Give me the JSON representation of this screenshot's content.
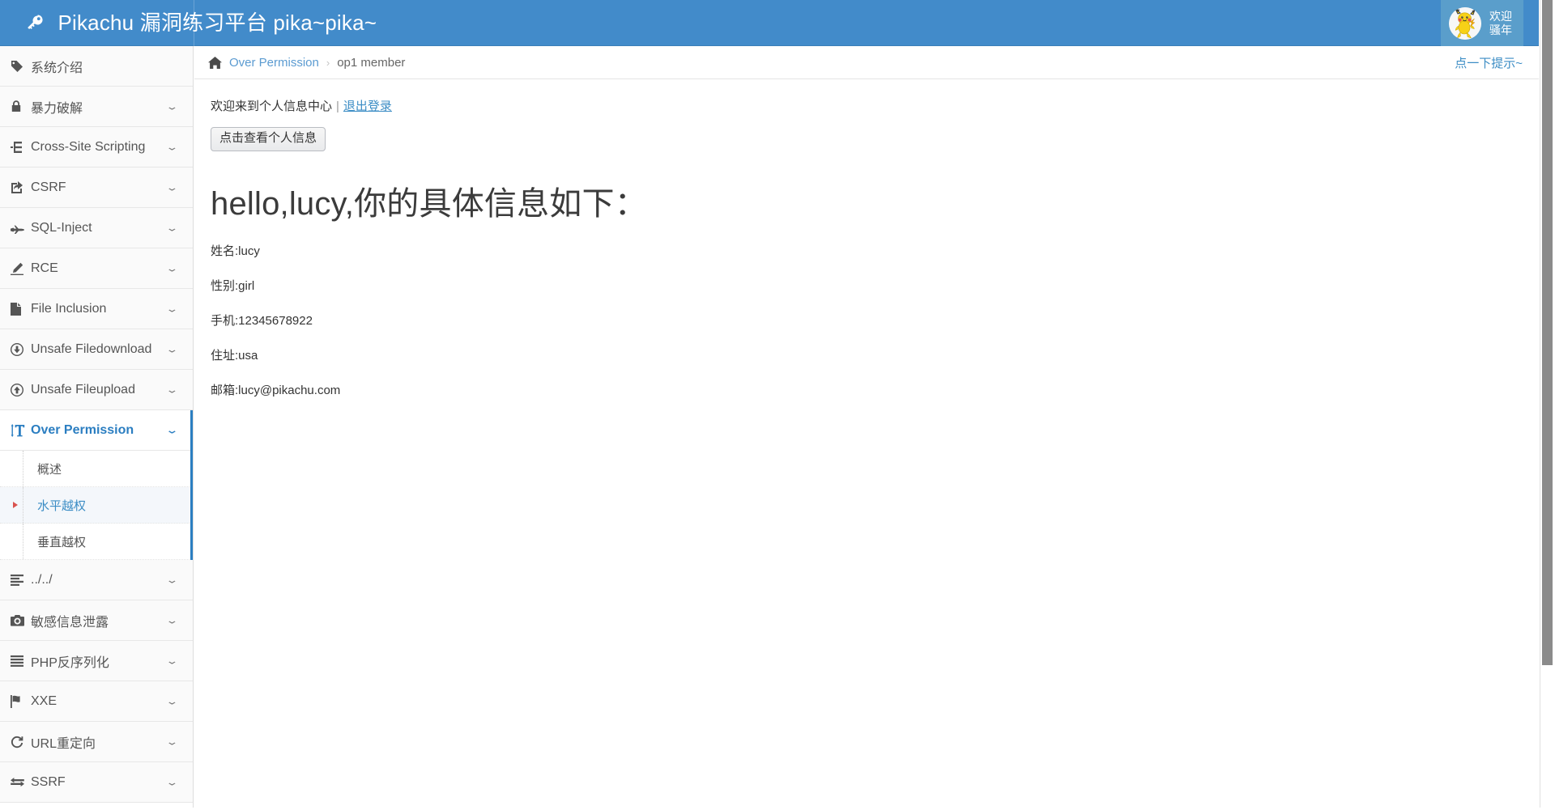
{
  "header": {
    "title": "Pikachu 漏洞练习平台 pika~pika~",
    "key_icon": "key-icon",
    "user": {
      "avatar": "pikachu-avatar",
      "line1": "欢迎",
      "line2": "骚年"
    },
    "colors": {
      "brand_blue": "#428bca",
      "user_box_blue": "#5a9ecb",
      "accent": "#2b7ec1"
    }
  },
  "sidebar": {
    "items": [
      {
        "label": "系统介绍",
        "icon": "tag-icon",
        "chevron": "",
        "active": false
      },
      {
        "label": "暴力破解",
        "icon": "lock-icon",
        "chevron": "⌄",
        "active": false
      },
      {
        "label": "Cross-Site Scripting",
        "icon": "sitemap-icon",
        "chevron": "⌄",
        "active": false
      },
      {
        "label": "CSRF",
        "icon": "share-square-icon",
        "chevron": "⌄",
        "active": false
      },
      {
        "label": "SQL-Inject",
        "icon": "plane-icon",
        "chevron": "⌄",
        "active": false
      },
      {
        "label": "RCE",
        "icon": "pencil-icon",
        "chevron": "⌄",
        "active": false
      },
      {
        "label": "File Inclusion",
        "icon": "file-icon",
        "chevron": "⌄",
        "active": false
      },
      {
        "label": "Unsafe Filedownload",
        "icon": "arrow-circle-down-icon",
        "chevron": "⌄",
        "active": false
      },
      {
        "label": "Unsafe Fileupload",
        "icon": "arrow-circle-up-icon",
        "chevron": "⌄",
        "active": false
      },
      {
        "label": "Over Permission",
        "icon": "text-height-icon",
        "chevron": "⌄",
        "active": true
      },
      {
        "label": "../../",
        "icon": "list-icon",
        "chevron": "⌄",
        "active": false
      },
      {
        "label": "敏感信息泄露",
        "icon": "camera-icon",
        "chevron": "⌄",
        "active": false
      },
      {
        "label": "PHP反序列化",
        "icon": "bars-icon",
        "chevron": "⌄",
        "active": false
      },
      {
        "label": "XXE",
        "icon": "flag-icon",
        "chevron": "⌄",
        "active": false
      },
      {
        "label": "URL重定向",
        "icon": "refresh-icon",
        "chevron": "⌄",
        "active": false
      },
      {
        "label": "SSRF",
        "icon": "exchange-icon",
        "chevron": "⌄",
        "active": false
      }
    ],
    "submenu": [
      {
        "label": "概述",
        "active": false
      },
      {
        "label": "水平越权",
        "active": true
      },
      {
        "label": "垂直越权",
        "active": false
      }
    ]
  },
  "breadcrumb": {
    "home_icon": "home-icon",
    "parent": "Over Permission",
    "separator": "›",
    "current": "op1 member",
    "hint_link": "点一下提示~"
  },
  "main": {
    "greeting_prefix": "欢迎来到个人信息中心",
    "greeting_separator": "|",
    "logout_label": "退出登录",
    "view_info_button": "点击查看个人信息",
    "member_title": "hello,lucy,你的具体信息如下：",
    "info_rows": [
      "姓名:lucy",
      "性别:girl",
      "手机:12345678922",
      "住址:usa",
      "邮箱:lucy@pikachu.com"
    ]
  }
}
